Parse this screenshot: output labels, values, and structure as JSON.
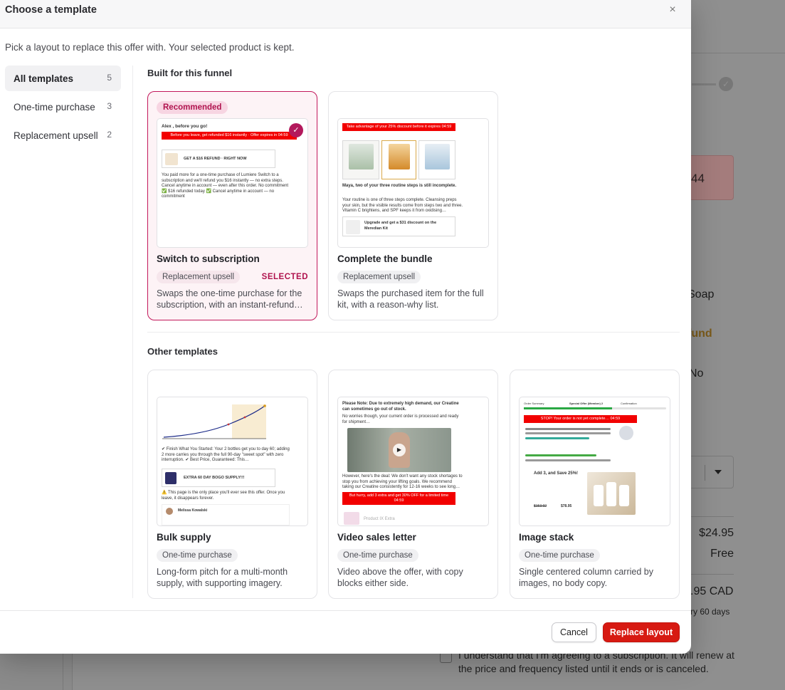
{
  "background": {
    "pink_box_text": "44",
    "line_soap": "Soap",
    "line_refund": "fund",
    "line_no": "No",
    "price": "$24.95",
    "shipping": "Free",
    "total": ".95 CAD",
    "every": "ry 60 days",
    "consent": "I understand that I'm agreeing to a subscription. It will renew at the price and frequency listed until it ends or is canceled."
  },
  "modal": {
    "title": "Choose a template",
    "close_glyph": "×",
    "subtitle": "Pick a layout to replace this offer with. Your selected product is kept."
  },
  "sidebar": {
    "items": [
      {
        "label": "All templates",
        "count": "5"
      },
      {
        "label": "One-time purchase",
        "count": "3"
      },
      {
        "label": "Replacement upsell",
        "count": "2"
      }
    ]
  },
  "sections": {
    "built": "Built for this funnel",
    "other": "Other templates"
  },
  "cards": [
    {
      "badge": "Recommended",
      "name": "Switch to subscription",
      "tag": "Replacement upsell",
      "selected_label": "SELECTED",
      "desc": "Swaps the one-time purchase for the subscription, with an instant-refund…",
      "thumb": {
        "greeting": "Alex , before you go!",
        "red": "Before you leave, get refunded $16 instantly · Offer expires in 04:59",
        "offer": "GET A $16 REFUND · RIGHT NOW",
        "body": "You paid more for a one-time purchase of Lumiere Switch to a subscription and we'll refund you $16 instantly — no extra steps. Cancel anytime in account — even after this order. No commitment ✅ $16 refunded today ✅ Cancel anytime in account — no commitment"
      }
    },
    {
      "name": "Complete the bundle",
      "tag": "Replacement upsell",
      "desc": "Swaps the purchased item for the full kit, with a reason-why list.",
      "thumb": {
        "red": "Take advantage of your 25% discount before it expires 04:59",
        "headline": "Maya, two of your three routine steps is still incomplete.",
        "body": "Your routine is one of three steps complete. Cleansing preps your skin, but the visible results come from steps two and three. Vitamin C brightens, and SPF keeps it from oxidising…",
        "offer": "Upgrade and get a $31 discount on the Meredian Kit"
      }
    },
    {
      "name": "Bulk supply",
      "tag": "One-time purchase",
      "desc": "Long-form pitch for a multi-month supply, with supporting imagery.",
      "thumb": {
        "body": "✔ Finish What You Started: Your 2 bottles get you to day 60; adding 2 more carries you through the full 90-day \"sweet spot\" with zero interruption. ✔ Best Price, Guaranteed: This…",
        "offer": "EXTRA 60 DAY BOGO SUPPLY!!!",
        "warning": "⚠️ This page is the only place you'll ever see this offer. Once you leave, it disappears forever.",
        "reviewer": "Melissa Kowalski"
      }
    },
    {
      "name": "Video sales letter",
      "tag": "One-time purchase",
      "desc": "Video above the offer, with copy blocks either side.",
      "thumb": {
        "headline": "Please Note: Due to extremely high demand, our Creatine can sometimes go out of stock.",
        "sub": "No worries though, your current order is processed and ready for shipment…",
        "body": "However, here's the deal: We don't want any stock shortages to stop you from achieving your lifting goals. We recommend taking our Creatine consistently for 12-16 weeks to see long…",
        "red": "But hurry, add 3 extra and get 30% OFF for a limited time 04:59",
        "product": "Product IX Extra"
      }
    },
    {
      "name": "Image stack",
      "tag": "One-time purchase",
      "desc": "Single centered column carried by images, no body copy.",
      "thumb": {
        "step1": "Order Summary",
        "step2": "Special Offer (Member) 2",
        "step3": "Confirmation",
        "red": "STOP! Your order is not yet complete… 04:59",
        "offer": "Add 3, and Save 25%!",
        "price_old": "$153.92",
        "price_new": "$78.95"
      }
    }
  ],
  "footer": {
    "cancel": "Cancel",
    "primary": "Replace layout"
  },
  "colors": {
    "accent": "#c2185b",
    "primary_button": "#d71a12"
  }
}
